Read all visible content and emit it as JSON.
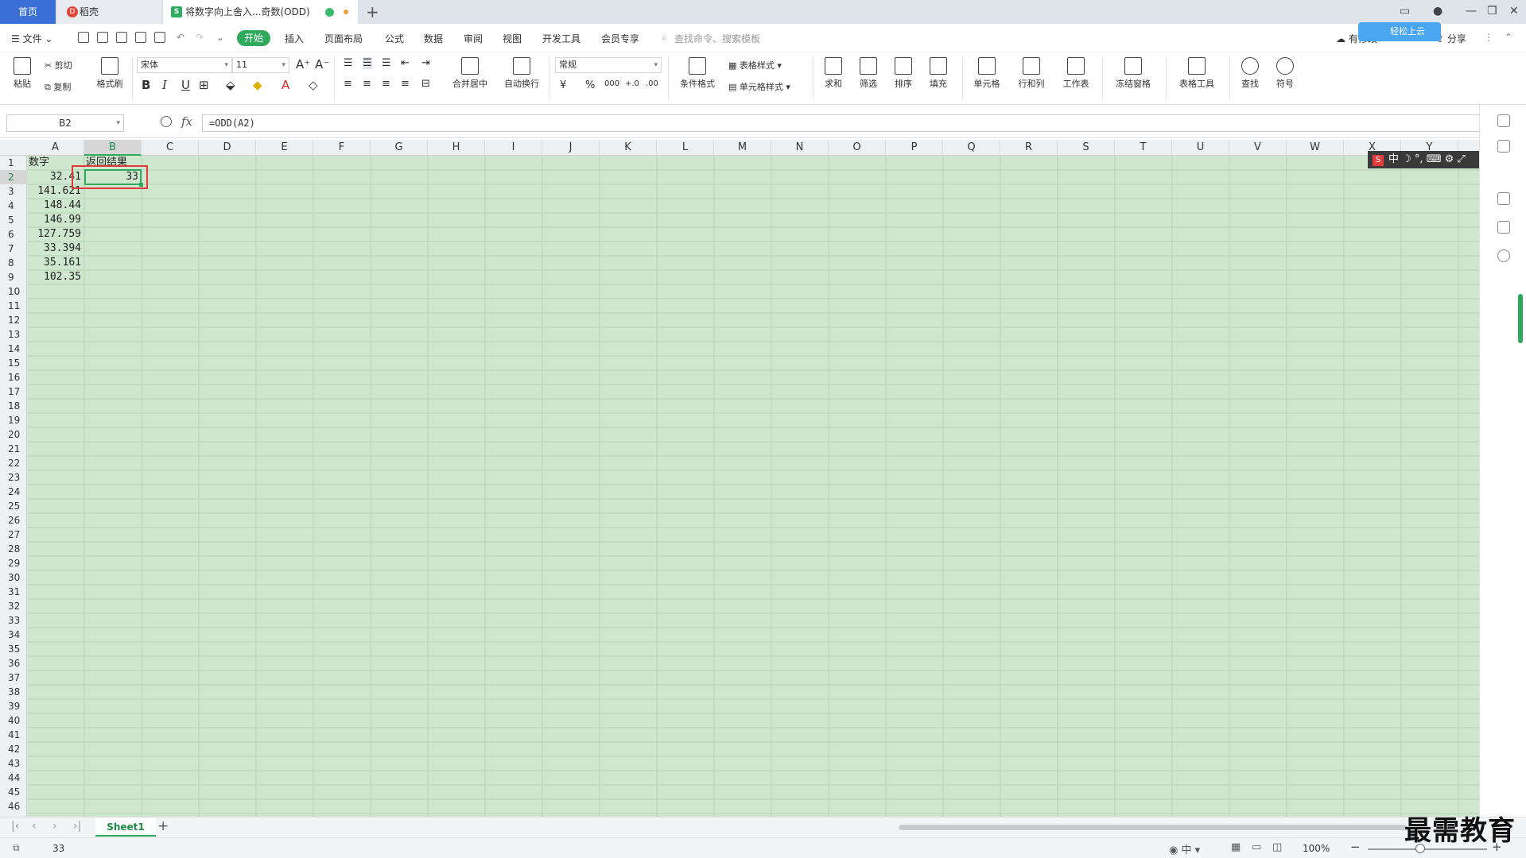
{
  "tabs": {
    "home": "首页",
    "daoke": "稻壳",
    "doc": "将数字向上舍入...奇数(ODD)"
  },
  "menu": {
    "file": "文件",
    "start": "开始",
    "insert": "插入",
    "page_layout": "页面布局",
    "formula": "公式",
    "data": "数据",
    "review": "审阅",
    "view": "视图",
    "dev_tools": "开发工具",
    "member": "会员专享",
    "search_placeholder": "查找命令、搜索模板",
    "sync": "有修改",
    "share": "分享",
    "cloud_badge": "轻松上云"
  },
  "ribbon": {
    "paste": "粘贴",
    "cut": "剪切",
    "copy": "复制",
    "format_painter": "格式刷",
    "font_name": "宋体",
    "font_size": "11",
    "merge_center": "合并居中",
    "wrap_text": "自动换行",
    "number_format": "常规",
    "conditional_format": "条件格式",
    "table_style": "表格样式",
    "cell_style": "单元格样式",
    "sum": "求和",
    "filter": "筛选",
    "sort": "排序",
    "fill": "填充",
    "cell": "单元格",
    "row_col": "行和列",
    "worksheet": "工作表",
    "freeze": "冻结窗格",
    "table_tools": "表格工具",
    "find": "查找",
    "symbol": "符号",
    "bold": "B",
    "italic": "I",
    "underline": "U",
    "currency": "¥",
    "percent": "%",
    "thousands": "000",
    "inc_decimal": "+.0",
    "dec_decimal": ".00"
  },
  "formula_bar": {
    "name_box": "B2",
    "fx": "fx",
    "formula": "=ODD(A2)"
  },
  "grid": {
    "columns": [
      "A",
      "B",
      "C",
      "D",
      "E",
      "F",
      "G",
      "H",
      "I",
      "J",
      "K",
      "L",
      "M",
      "N",
      "O",
      "P",
      "Q",
      "R",
      "S",
      "T",
      "U",
      "V",
      "W",
      "X",
      "Y"
    ],
    "rows": [
      "1",
      "2",
      "3",
      "4",
      "5",
      "6",
      "7",
      "8",
      "9",
      "10",
      "11",
      "12",
      "13",
      "14",
      "15",
      "16",
      "17",
      "18",
      "19",
      "20",
      "21",
      "22",
      "23",
      "24",
      "25",
      "26",
      "27",
      "28",
      "29",
      "30",
      "31",
      "32",
      "33",
      "34",
      "35",
      "36",
      "37",
      "38",
      "39",
      "40",
      "41",
      "42",
      "43",
      "44",
      "45",
      "46"
    ],
    "header_a": "数字",
    "header_b": "返回结果",
    "values_a": [
      "32.41",
      "141.621",
      "148.44",
      "146.99",
      "127.759",
      "33.394",
      "35.161",
      "102.35"
    ],
    "result_b2": "33",
    "selected_cell": "B2"
  },
  "ime": {
    "logo": "S",
    "mode": "中"
  },
  "sheets": {
    "active": "Sheet1"
  },
  "status": {
    "value": "33",
    "zoom": "100%"
  },
  "watermark": "最需教育",
  "colors": {
    "accent": "#2faa5c",
    "grid_bg": "#cfe7cf",
    "highlight": "#e03a3a"
  }
}
